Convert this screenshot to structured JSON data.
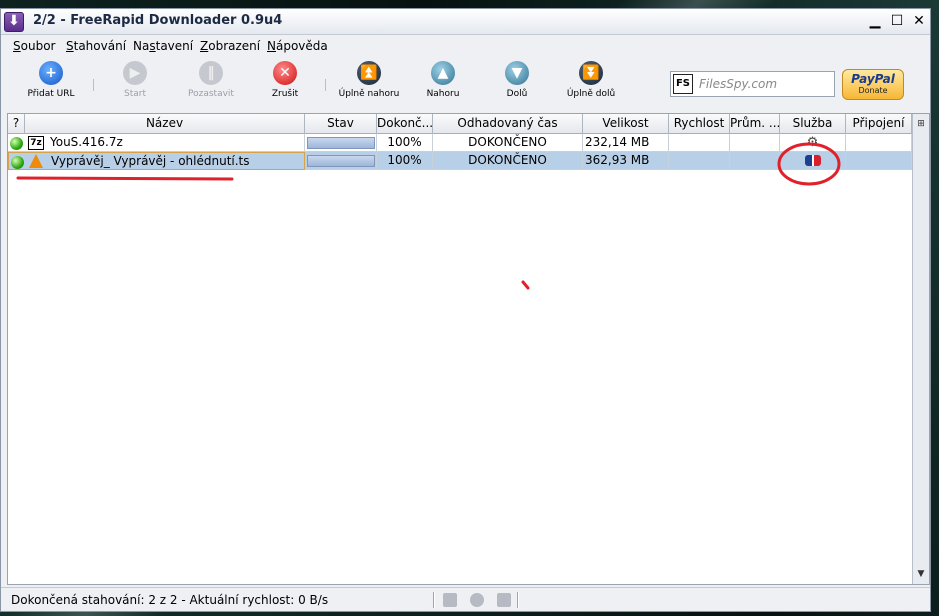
{
  "window": {
    "title": "2/2 - FreeRapid Downloader 0.9u4"
  },
  "menu": [
    {
      "label": "Soubor",
      "u": "S",
      "rest": "oubor"
    },
    {
      "label": "Stahování",
      "u": "S",
      "rest": "tahování"
    },
    {
      "label": "Nastavení",
      "pre": "Na",
      "u": "s",
      "rest": "tavení"
    },
    {
      "label": "Zobrazení",
      "u": "Z",
      "rest": "obrazení"
    },
    {
      "label": "Nápověda",
      "u": "N",
      "rest": "ápověda"
    }
  ],
  "toolbar": {
    "add": "Přidat URL",
    "start": "Start",
    "pause": "Pozastavit",
    "cancel": "Zrušit",
    "top": "Úplně nahoru",
    "up": "Nahoru",
    "down": "Dolů",
    "bottom": "Úplně dolů"
  },
  "filespy": {
    "logo": "FS",
    "placeholder": "FilesSpy.com"
  },
  "paypal": {
    "logo": "PayPal",
    "sub": "Donate"
  },
  "columns": [
    "?",
    "Název",
    "Stav",
    "Dokonč...",
    "Odhadovaný čas",
    "Velikost",
    "Rychlost",
    "Prům. ...",
    "Služba",
    "Připojení"
  ],
  "rows": [
    {
      "type_icon": "7z",
      "name": "YouS.416.7z",
      "progress": 1.0,
      "complete": "100%",
      "eta": "DOKONČENO",
      "size": "232,14 MB",
      "speed": "",
      "avg": "",
      "service_icon": "gear-icon",
      "connection": ""
    },
    {
      "type_icon": "vlc",
      "name": "Vyprávěj_ Vyprávěj - ohlédnutí.ts",
      "progress": 1.0,
      "complete": "100%",
      "eta": "DOKONČENO",
      "size": "362,93 MB",
      "speed": "",
      "avg": "",
      "service_icon": "ceska-televize-icon",
      "connection": ""
    }
  ],
  "status": {
    "text": "Dokončená stahování: 2 z 2 - Aktuální rychlost: 0 B/s"
  },
  "colors": {
    "annotation": "#e0202a",
    "selection": "#b8cfe8"
  }
}
